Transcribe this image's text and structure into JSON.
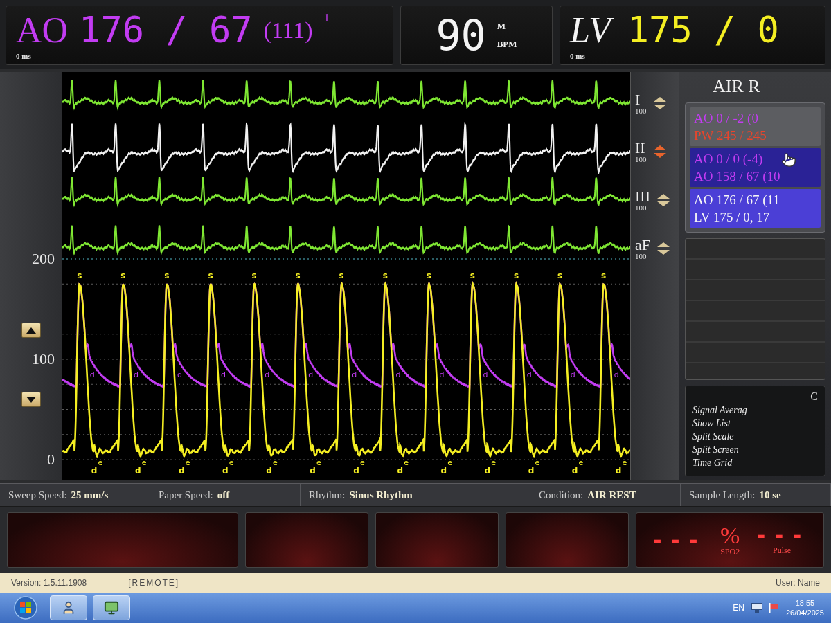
{
  "readouts": [
    {
      "kind": "pressure",
      "channel": {
        "text": "AO",
        "color": "#c23cf2"
      },
      "reading": {
        "text": "176 / 67",
        "color": "#c23cf2"
      },
      "mean": "(111)",
      "index": "1",
      "delay": "0 ms"
    },
    {
      "kind": "rate",
      "value": "90",
      "source": "M",
      "unit": "BPM"
    },
    {
      "kind": "pressure",
      "channel": {
        "text": "LV",
        "color": "#f4f4f4"
      },
      "reading": {
        "text": "175 / 0",
        "color": "#f4ee22"
      },
      "delay": "0 ms"
    }
  ],
  "scale": {
    "ticks": [
      "200",
      "100",
      "0"
    ]
  },
  "leads": [
    {
      "name": "I",
      "gain": "100",
      "color": "#7fe733",
      "selected": false
    },
    {
      "name": "II",
      "gain": "100",
      "color": "#f2f2f2",
      "selected": true
    },
    {
      "name": "III",
      "gain": "100",
      "color": "#7fe733",
      "selected": false
    },
    {
      "name": "aF",
      "gain": "100",
      "color": "#7fe733",
      "selected": false
    }
  ],
  "pressure_traces": [
    {
      "kind": "aortic",
      "color": "#c23cf2"
    },
    {
      "kind": "ventricular",
      "color": "#f4ee22"
    }
  ],
  "beats": [
    {
      "peak": "s",
      "notch": "d",
      "trough": "d",
      "end": "e"
    },
    {
      "peak": "s",
      "notch": "d",
      "trough": "d",
      "end": "e"
    },
    {
      "peak": "s",
      "notch": "d",
      "trough": "d",
      "end": "e"
    },
    {
      "peak": "s",
      "notch": "d",
      "trough": "d",
      "end": "e"
    },
    {
      "peak": "s",
      "notch": "d",
      "trough": "d",
      "end": "e"
    },
    {
      "peak": "s",
      "notch": "d",
      "trough": "d",
      "end": "e"
    },
    {
      "peak": "s",
      "notch": "d",
      "trough": "d",
      "end": "e"
    },
    {
      "peak": "s",
      "notch": "d",
      "trough": "d",
      "end": "e"
    },
    {
      "peak": "s",
      "notch": "d",
      "trough": "d",
      "end": "e"
    },
    {
      "peak": "s",
      "notch": "d",
      "trough": "d",
      "end": "e"
    },
    {
      "peak": "s",
      "notch": "d",
      "trough": "d",
      "end": "e"
    },
    {
      "peak": "s",
      "notch": "d",
      "trough": "d",
      "end": "e"
    },
    {
      "peak": "s",
      "notch": "d",
      "trough": "d",
      "end": "e"
    }
  ],
  "panel": {
    "title": "AIR R",
    "groups": [
      {
        "selected": false,
        "hovered": false,
        "items": [
          {
            "label": "AO 0 / -2 (0",
            "color": "#c23cf2"
          },
          {
            "label": "PW 245 / 245",
            "color": "#e8452c"
          }
        ]
      },
      {
        "selected": false,
        "hovered": true,
        "items": [
          {
            "label": "AO 0 / 0 (-4)",
            "color": "#c23cf2"
          },
          {
            "label": "AO 158 / 67 (10",
            "color": "#c23cf2"
          }
        ]
      },
      {
        "selected": true,
        "hovered": false,
        "items": [
          {
            "label": "AO 176 / 67 (11"
          },
          {
            "label": "LV 175 / 0, 17"
          }
        ]
      }
    ],
    "options_title": "C",
    "options": [
      "Signal Averag",
      "Show List",
      "Split Scale",
      "Split Screen",
      "Time Grid"
    ]
  },
  "info_bar": [
    {
      "label": "Sweep Speed:",
      "value": "25 mm/s"
    },
    {
      "label": "Paper Speed:",
      "value": "off"
    },
    {
      "label": "Rhythm:",
      "value": "Sinus Rhythm"
    },
    {
      "label": "Condition:",
      "value": "AIR REST"
    },
    {
      "label": "Sample Length:",
      "value": "10 se"
    }
  ],
  "displays": [
    {
      "kind": "blank"
    },
    {
      "kind": "blank"
    },
    {
      "kind": "blank"
    },
    {
      "kind": "blank"
    },
    {
      "kind": "oximetry",
      "reading": "---",
      "unit": "%",
      "label": "SPO2",
      "pulse_reading": "---",
      "pulse_label": "Pulse"
    }
  ],
  "status_bar": {
    "version": "Version: 1.5.11.1908",
    "mode": "[REMOTE]",
    "user": "User: Name"
  },
  "taskbar": {
    "language": "EN",
    "time": "18:55",
    "date": "26/04/2025"
  }
}
